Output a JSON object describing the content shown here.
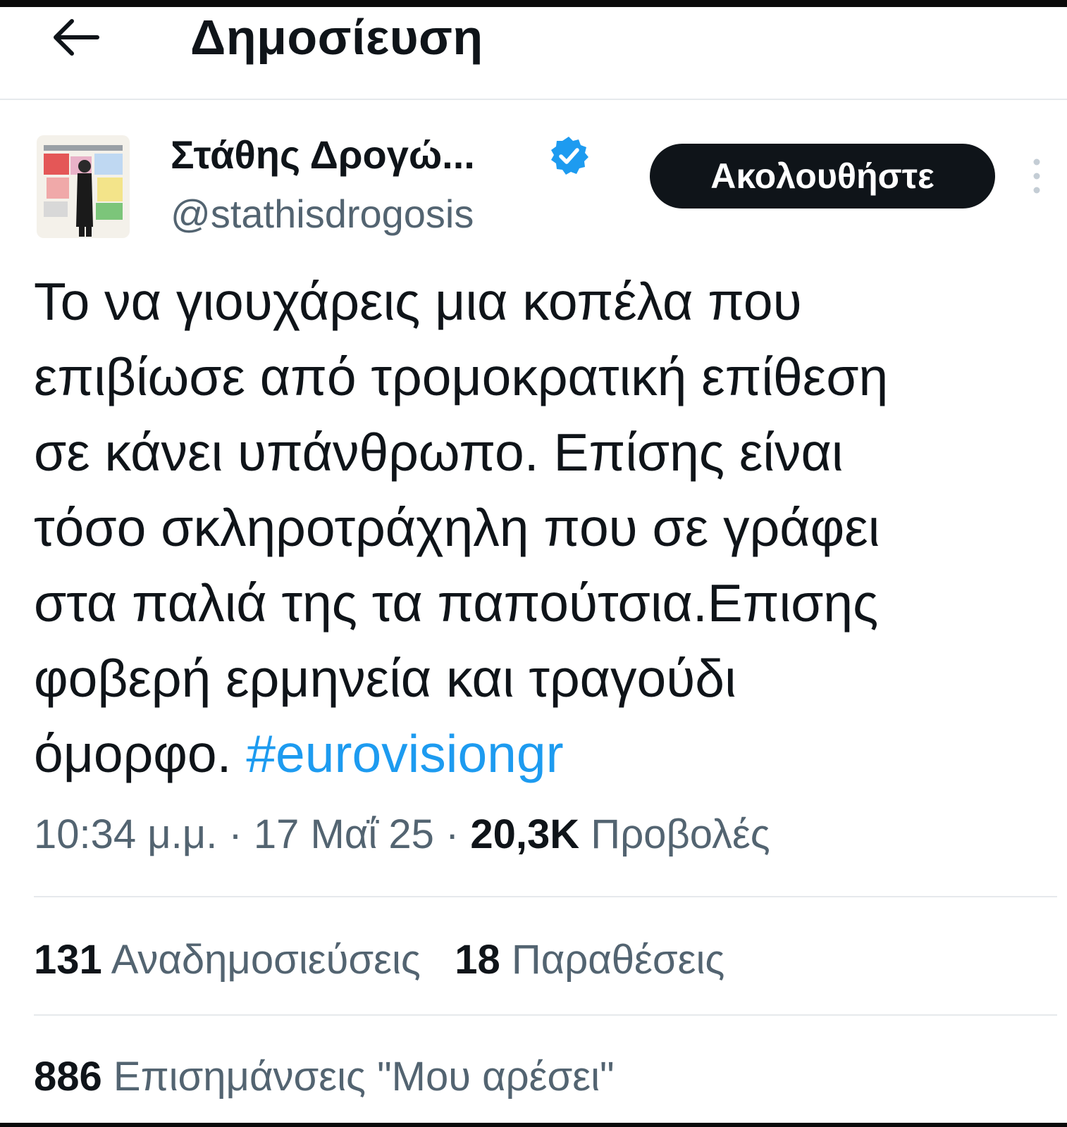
{
  "header": {
    "title": "Δημοσίευση"
  },
  "author": {
    "name": "Στάθης Δρογώ...",
    "handle": "@stathisdrogosis",
    "follow_label": "Ακολουθήστε"
  },
  "tweet": {
    "lines": [
      "Το να γιουχάρεις μια κοπέλα που",
      "επιβίωσε από τρομοκρατική επίθεση",
      "σε κάνει υπάνθρωπο. Επίσης είναι",
      "τόσο σκληροτράχηλη που σε γράφει",
      "στα παλιά της τα παπούτσια.Επισης",
      "φοβερή ερμηνεία και τραγούδι"
    ],
    "last_line_text": "όμορφο. ",
    "hashtag": "#eurovisiongr"
  },
  "meta": {
    "time_date": "10:34 μ.μ. · 17 Μαΐ 25 · ",
    "views_count": "20,3K",
    "views_label": " Προβολές"
  },
  "stats": {
    "reposts_count": "131",
    "reposts_label": " Αναδημοσιεύσεις",
    "quotes_count": "18",
    "quotes_label": " Παραθέσεις",
    "likes_count": "886",
    "likes_label": " Επισημάνσεις \"Μου αρέσει\""
  },
  "colors": {
    "accent": "#1d9bf0",
    "text": "#0f1419",
    "secondary": "#536471",
    "divider": "#e6e9ec"
  }
}
